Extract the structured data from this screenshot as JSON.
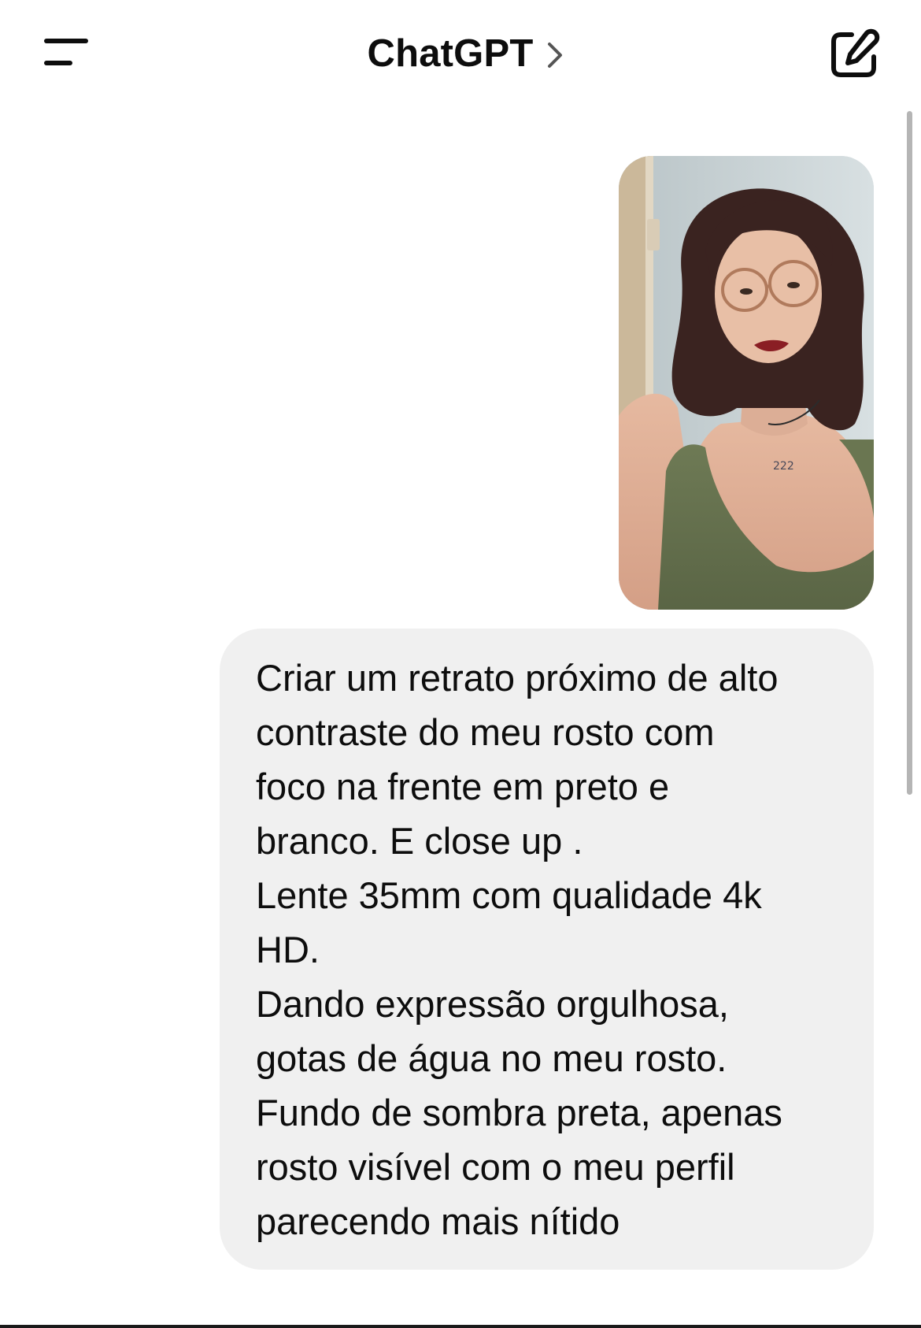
{
  "header": {
    "title": "ChatGPT",
    "menu_icon": "menu-lines-icon",
    "chevron_icon": "chevron-right-icon",
    "new_chat_icon": "edit-square-icon"
  },
  "attachment": {
    "type": "image",
    "alt": "uploaded photo"
  },
  "message": {
    "lines": [
      "Criar um retrato próximo de alto",
      "contraste do meu rosto com",
      "foco na frente em preto e",
      "branco. E close up .",
      "Lente 35mm com qualidade 4k",
      "HD.",
      "Dando expressão orgulhosa,",
      "gotas de água no meu rosto.",
      "Fundo de sombra preta, apenas",
      "rosto visível com o meu perfil",
      "parecendo mais nítido"
    ]
  },
  "colors": {
    "bubble_background": "#f0f0f0",
    "text": "#0d0d0d",
    "scrollbar": "#b5b5b5",
    "background": "#ffffff"
  }
}
